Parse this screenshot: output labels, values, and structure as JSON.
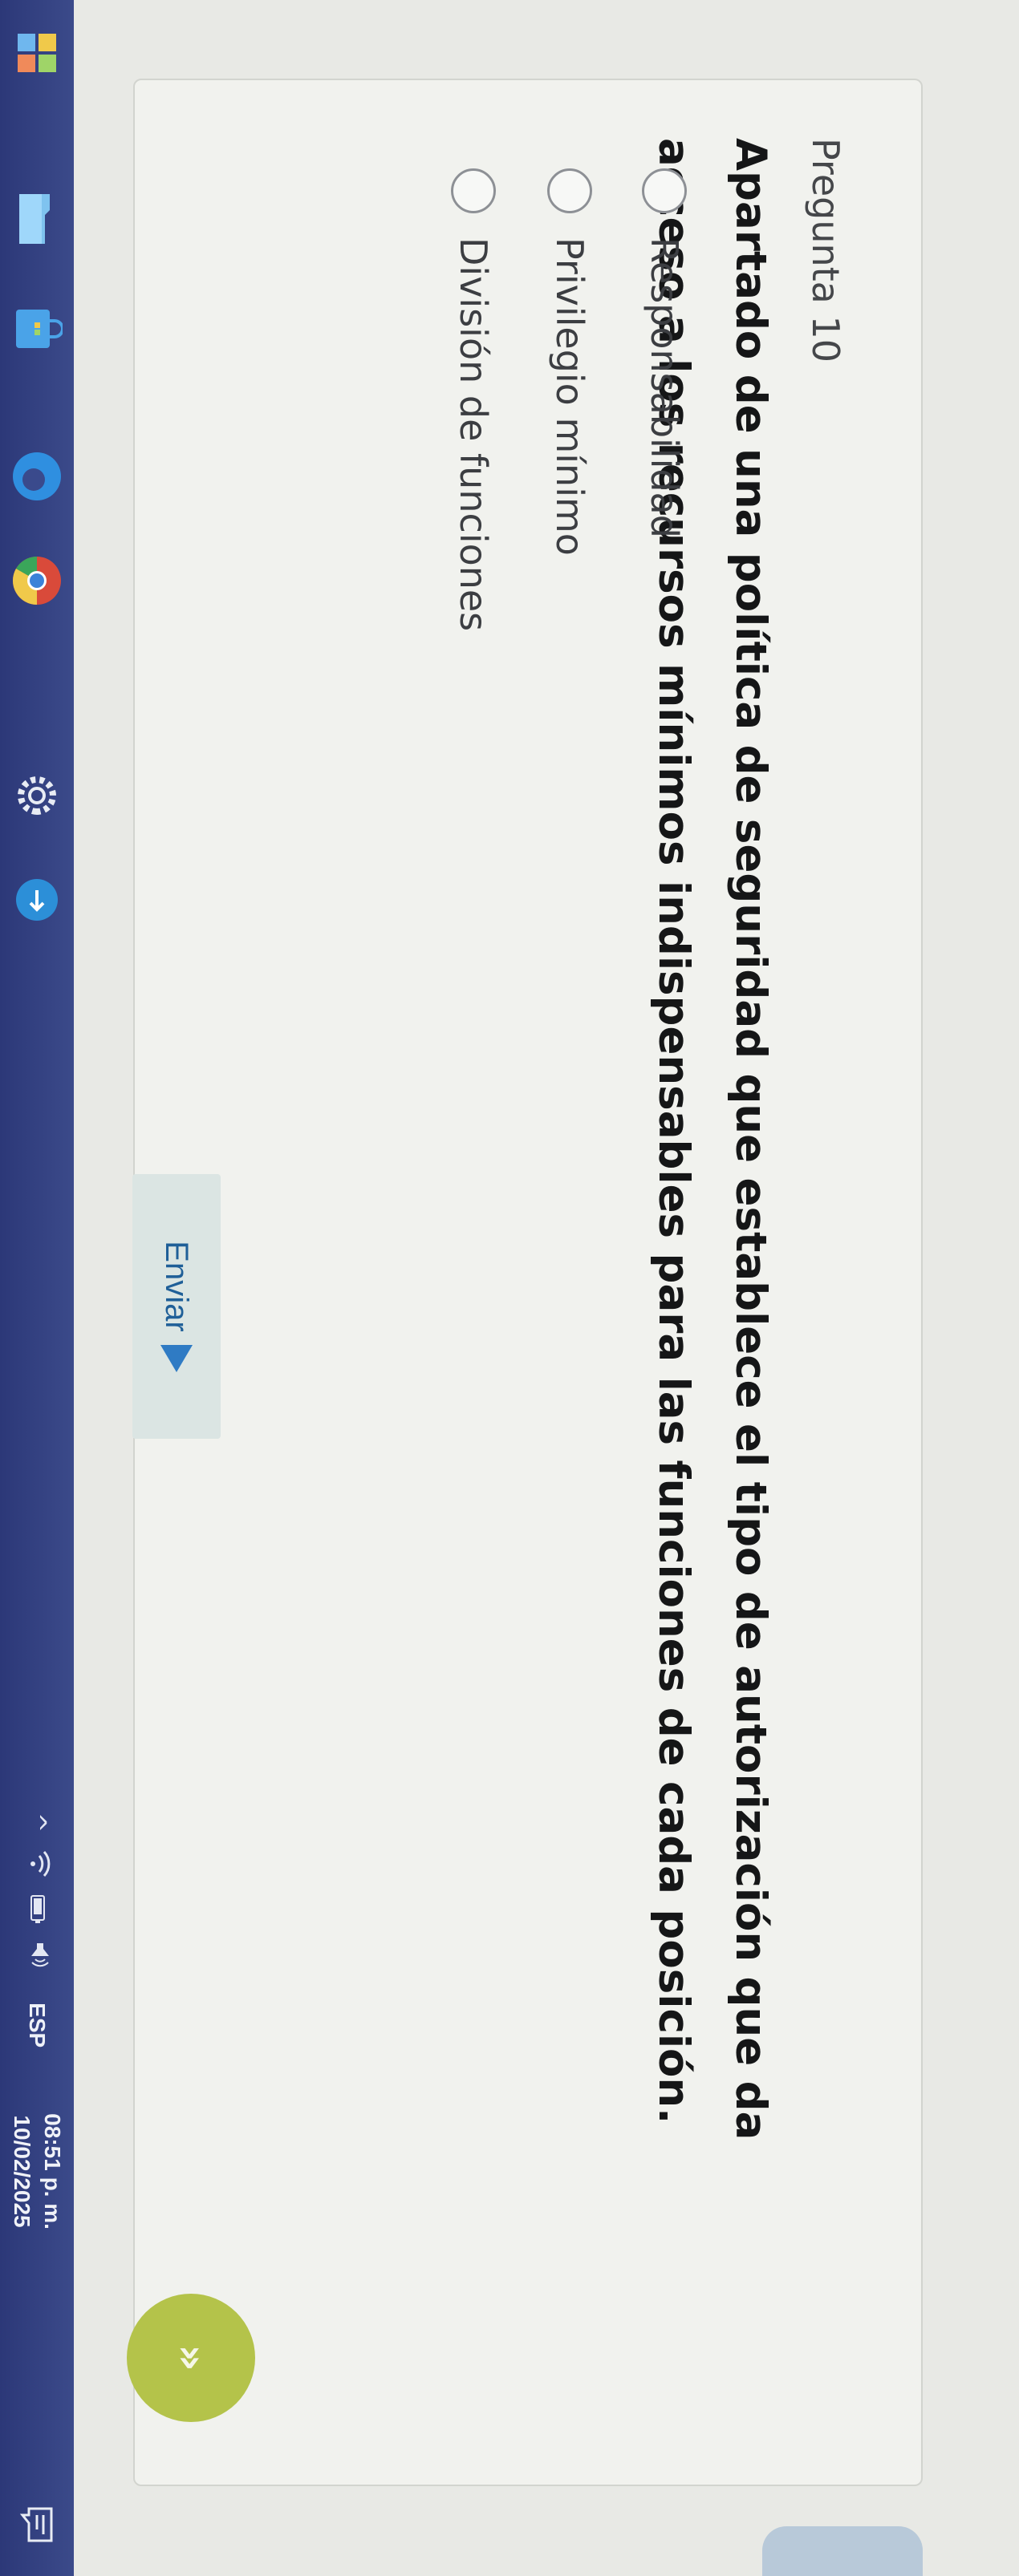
{
  "question": {
    "number_label": "Pregunta 10",
    "text": "Apartado de una política de seguridad que establece el tipo de autorización que da acceso a los recursos mínimos indispensables para las funciones de cada posición.",
    "options": [
      {
        "label": "Responsabilidad",
        "selected": false
      },
      {
        "label": "Privilegio mínimo",
        "selected": false
      },
      {
        "label": "División de funciones",
        "selected": false
      }
    ]
  },
  "actions": {
    "submit_label": "Enviar",
    "next_label": "»"
  },
  "taskbar": {
    "language": "ESP",
    "time": "08:51 p. m.",
    "date": "10/02/2025",
    "tray_expand_glyph": "^"
  },
  "colors": {
    "accent_green": "#b4c34a",
    "submit_text": "#1f5f98",
    "taskbar": "#2c3878"
  }
}
